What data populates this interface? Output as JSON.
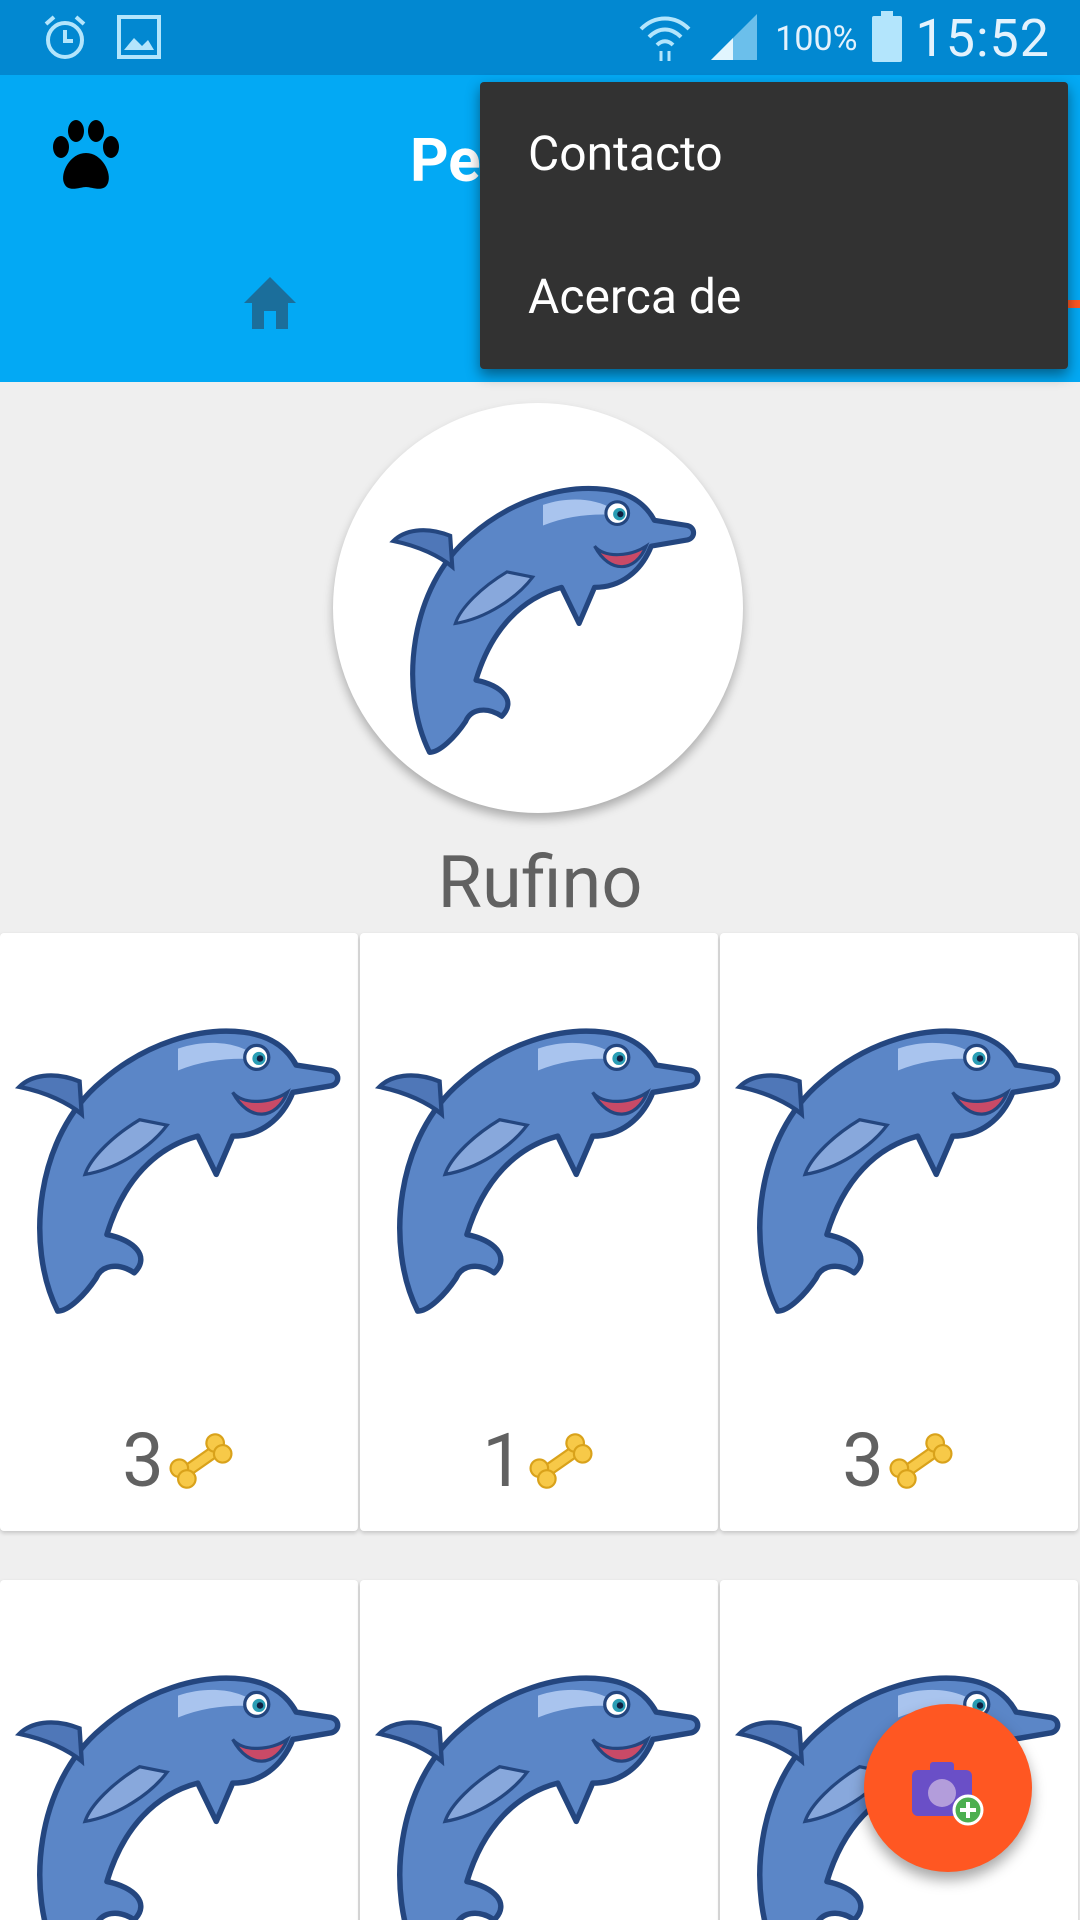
{
  "status_bar": {
    "battery_percent": "100%",
    "time": "15:52",
    "icons": [
      "alarm-icon",
      "image-icon",
      "wifi-icon",
      "signal-icon",
      "battery-icon"
    ]
  },
  "app_bar": {
    "title": "Pe",
    "tabs": [
      {
        "name": "home",
        "icon": "home-icon",
        "selected": false
      },
      {
        "name": "pet",
        "icon": "dog-icon",
        "selected": true
      }
    ],
    "colors": {
      "primary_dark": "#0288d1",
      "primary": "#03a9f4",
      "accent": "#ff5722"
    }
  },
  "menu": {
    "items": [
      {
        "label": "Contacto"
      },
      {
        "label": "Acerca de"
      }
    ]
  },
  "profile": {
    "name": "Rufino"
  },
  "grid": {
    "items": [
      {
        "likes": "3"
      },
      {
        "likes": "1"
      },
      {
        "likes": "3"
      },
      {
        "likes": ""
      },
      {
        "likes": ""
      },
      {
        "likes": ""
      }
    ]
  },
  "fab": {
    "icon": "add-photo-camera-icon"
  }
}
